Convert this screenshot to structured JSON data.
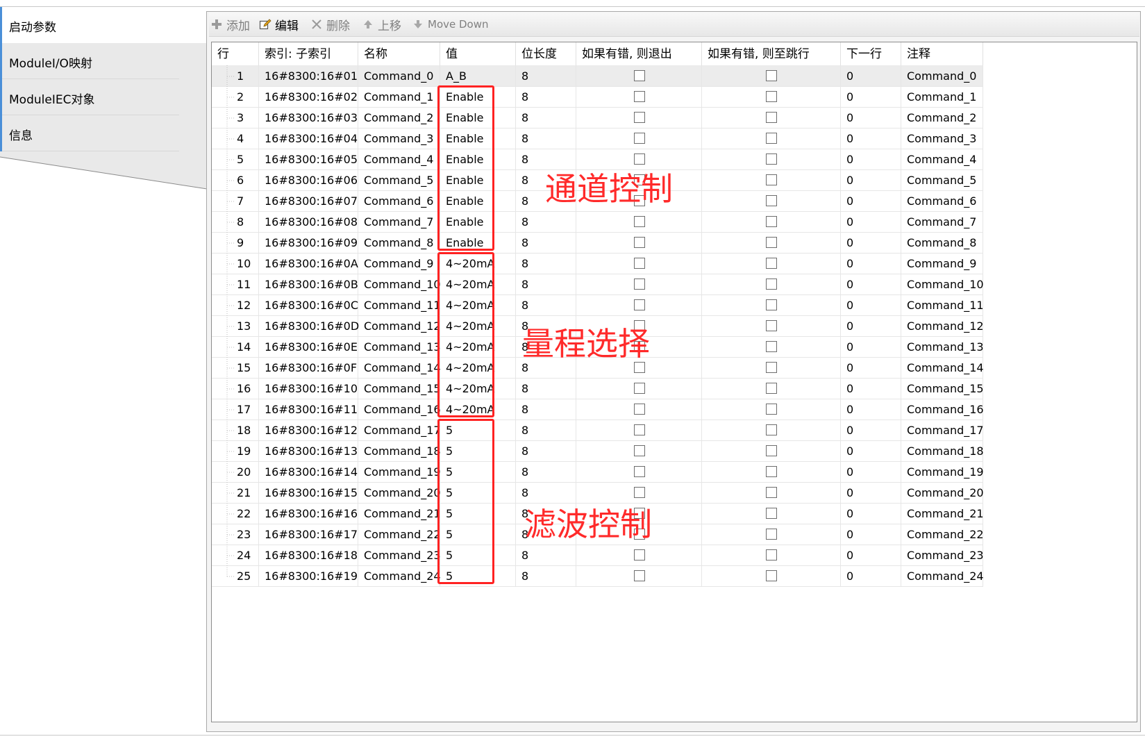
{
  "tabs": [
    {
      "label": "启动参数",
      "active": true
    },
    {
      "label": "ModuleI/O映射",
      "active": false
    },
    {
      "label": "ModuleIEC对象",
      "active": false
    },
    {
      "label": "信息",
      "active": false
    }
  ],
  "toolbar": {
    "add": "添加",
    "edit": "编辑",
    "delete": "删除",
    "move_up": "上移",
    "move_down": "Move Down"
  },
  "table": {
    "headers": [
      "行",
      "索引: 子索引",
      "名称",
      "值",
      "位长度",
      "如果有错, 则退出",
      "如果有错, 则至跳行",
      "下一行",
      "注释"
    ],
    "rows": [
      {
        "line": "1",
        "index": "16#8300:16#01",
        "name": "Command_0",
        "value": "A_B",
        "bitlen": "8",
        "next": "0",
        "comment": "Command_0"
      },
      {
        "line": "2",
        "index": "16#8300:16#02",
        "name": "Command_1",
        "value": "Enable",
        "bitlen": "8",
        "next": "0",
        "comment": "Command_1"
      },
      {
        "line": "3",
        "index": "16#8300:16#03",
        "name": "Command_2",
        "value": "Enable",
        "bitlen": "8",
        "next": "0",
        "comment": "Command_2"
      },
      {
        "line": "4",
        "index": "16#8300:16#04",
        "name": "Command_3",
        "value": "Enable",
        "bitlen": "8",
        "next": "0",
        "comment": "Command_3"
      },
      {
        "line": "5",
        "index": "16#8300:16#05",
        "name": "Command_4",
        "value": "Enable",
        "bitlen": "8",
        "next": "0",
        "comment": "Command_4"
      },
      {
        "line": "6",
        "index": "16#8300:16#06",
        "name": "Command_5",
        "value": "Enable",
        "bitlen": "8",
        "next": "0",
        "comment": "Command_5"
      },
      {
        "line": "7",
        "index": "16#8300:16#07",
        "name": "Command_6",
        "value": "Enable",
        "bitlen": "8",
        "next": "0",
        "comment": "Command_6"
      },
      {
        "line": "8",
        "index": "16#8300:16#08",
        "name": "Command_7",
        "value": "Enable",
        "bitlen": "8",
        "next": "0",
        "comment": "Command_7"
      },
      {
        "line": "9",
        "index": "16#8300:16#09",
        "name": "Command_8",
        "value": "Enable",
        "bitlen": "8",
        "next": "0",
        "comment": "Command_8"
      },
      {
        "line": "10",
        "index": "16#8300:16#0A",
        "name": "Command_9",
        "value": "4~20mA",
        "bitlen": "8",
        "next": "0",
        "comment": "Command_9"
      },
      {
        "line": "11",
        "index": "16#8300:16#0B",
        "name": "Command_10",
        "value": "4~20mA",
        "bitlen": "8",
        "next": "0",
        "comment": "Command_10"
      },
      {
        "line": "12",
        "index": "16#8300:16#0C",
        "name": "Command_11",
        "value": "4~20mA",
        "bitlen": "8",
        "next": "0",
        "comment": "Command_11"
      },
      {
        "line": "13",
        "index": "16#8300:16#0D",
        "name": "Command_12",
        "value": "4~20mA",
        "bitlen": "8",
        "next": "0",
        "comment": "Command_12"
      },
      {
        "line": "14",
        "index": "16#8300:16#0E",
        "name": "Command_13",
        "value": "4~20mA",
        "bitlen": "8",
        "next": "0",
        "comment": "Command_13"
      },
      {
        "line": "15",
        "index": "16#8300:16#0F",
        "name": "Command_14",
        "value": "4~20mA",
        "bitlen": "8",
        "next": "0",
        "comment": "Command_14"
      },
      {
        "line": "16",
        "index": "16#8300:16#10",
        "name": "Command_15",
        "value": "4~20mA",
        "bitlen": "8",
        "next": "0",
        "comment": "Command_15"
      },
      {
        "line": "17",
        "index": "16#8300:16#11",
        "name": "Command_16",
        "value": "4~20mA",
        "bitlen": "8",
        "next": "0",
        "comment": "Command_16"
      },
      {
        "line": "18",
        "index": "16#8300:16#12",
        "name": "Command_17",
        "value": "5",
        "bitlen": "8",
        "next": "0",
        "comment": "Command_17"
      },
      {
        "line": "19",
        "index": "16#8300:16#13",
        "name": "Command_18",
        "value": "5",
        "bitlen": "8",
        "next": "0",
        "comment": "Command_18"
      },
      {
        "line": "20",
        "index": "16#8300:16#14",
        "name": "Command_19",
        "value": "5",
        "bitlen": "8",
        "next": "0",
        "comment": "Command_19"
      },
      {
        "line": "21",
        "index": "16#8300:16#15",
        "name": "Command_20",
        "value": "5",
        "bitlen": "8",
        "next": "0",
        "comment": "Command_20"
      },
      {
        "line": "22",
        "index": "16#8300:16#16",
        "name": "Command_21",
        "value": "5",
        "bitlen": "8",
        "next": "0",
        "comment": "Command_21"
      },
      {
        "line": "23",
        "index": "16#8300:16#17",
        "name": "Command_22",
        "value": "5",
        "bitlen": "8",
        "next": "0",
        "comment": "Command_22"
      },
      {
        "line": "24",
        "index": "16#8300:16#18",
        "name": "Command_23",
        "value": "5",
        "bitlen": "8",
        "next": "0",
        "comment": "Command_23"
      },
      {
        "line": "25",
        "index": "16#8300:16#19",
        "name": "Command_24",
        "value": "5",
        "bitlen": "8",
        "next": "0",
        "comment": "Command_24"
      }
    ]
  },
  "annotations": {
    "channel_control": "通道控制",
    "range_select": "量程选择",
    "filter_control": "滤波控制",
    "color": "#ff2222"
  },
  "colors": {
    "tab_accent": "#4a8fd8",
    "selected_row": "#ececec"
  }
}
